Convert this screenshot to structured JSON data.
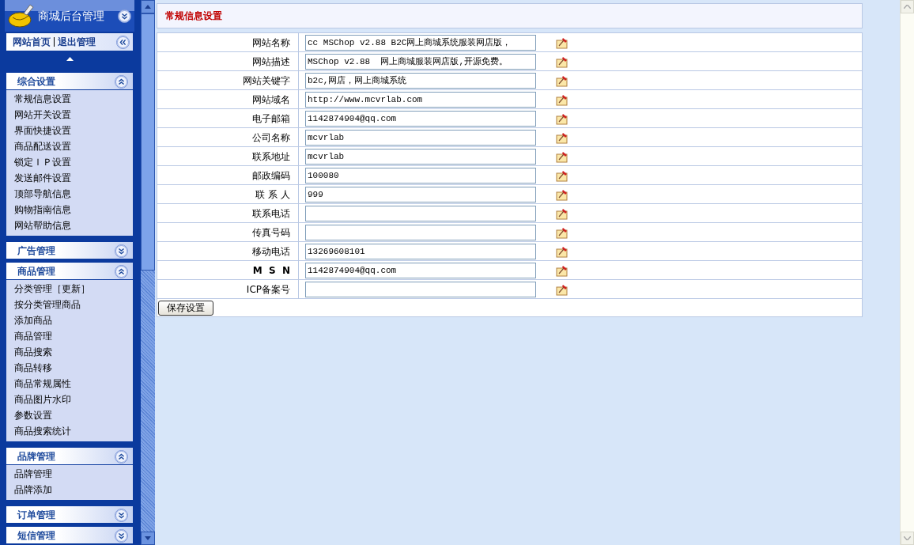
{
  "sidebar": {
    "title": "商城后台管理",
    "links": [
      {
        "label": "网站首页"
      },
      {
        "label": "退出管理"
      }
    ],
    "sections": [
      {
        "title": "综合设置",
        "expanded": true,
        "items": [
          "常规信息设置",
          "网站开关设置",
          "界面快捷设置",
          "商品配送设置",
          "锁定ＩＰ设置",
          "发送邮件设置",
          "顶部导航信息",
          "购物指南信息",
          "网站帮助信息"
        ]
      },
      {
        "title": "广告管理",
        "expanded": false
      },
      {
        "title": "商品管理",
        "expanded": true,
        "items": [
          "分类管理［更新］",
          "按分类管理商品",
          "添加商品",
          "商品管理",
          "商品搜索",
          "商品转移",
          "商品常规属性",
          "商品图片水印",
          "参数设置",
          "商品搜索统计"
        ]
      },
      {
        "title": "品牌管理",
        "expanded": true,
        "items": [
          "品牌管理",
          "品牌添加"
        ]
      },
      {
        "title": "订单管理",
        "expanded": false
      },
      {
        "title": "短信管理",
        "expanded": false
      }
    ]
  },
  "panel": {
    "title": "常规信息设置",
    "fields": [
      {
        "label": "网站名称",
        "bold": false,
        "value": "cc MSChop v2.88 B2C网上商城系统服装网店版，"
      },
      {
        "label": "网站描述",
        "bold": false,
        "value": "MSChop v2.88  网上商城服装网店版,开源免费。"
      },
      {
        "label": "网站关键字",
        "bold": false,
        "value": "b2c,网店，网上商城系统"
      },
      {
        "label": "网站域名",
        "bold": false,
        "value": "http://www.mcvrlab.com"
      },
      {
        "label": "电子邮箱",
        "bold": false,
        "value": "1142874904@qq.com"
      },
      {
        "label": "公司名称",
        "bold": false,
        "value": "mcvrlab"
      },
      {
        "label": "联系地址",
        "bold": false,
        "value": "mcvrlab"
      },
      {
        "label": "邮政编码",
        "bold": false,
        "value": "100080"
      },
      {
        "label": "联 系 人",
        "bold": false,
        "value": "999"
      },
      {
        "label": "联系电话",
        "bold": false
      },
      {
        "label": "传真号码",
        "bold": false
      },
      {
        "label": "移动电话",
        "bold": false,
        "value": "13269608101"
      },
      {
        "label": "M  S  N",
        "bold": true,
        "value": "1142874904@qq.com"
      },
      {
        "label": "ICP备案号",
        "bold": false
      }
    ],
    "save_button": "保存设置"
  }
}
